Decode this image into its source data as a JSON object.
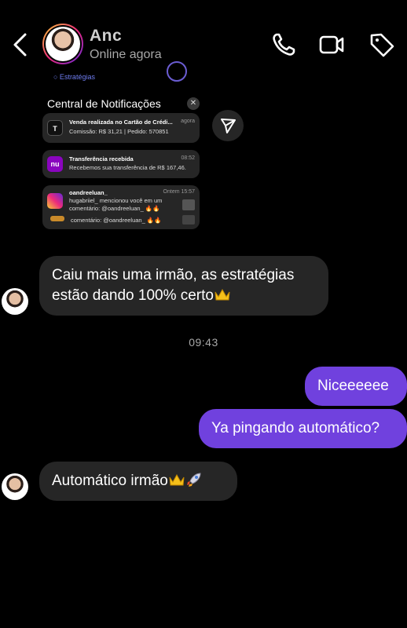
{
  "header": {
    "contact_name": "Anc",
    "status": "Online agora"
  },
  "screenshot": {
    "top_label": "○ Estratégias",
    "panel_title": "Central de Notificações",
    "close": "✕",
    "notifications": [
      {
        "icon_text": "T",
        "title": "Venda realizada no Cartão de Crédi...",
        "body": "Comissão: R$ 31,21 | Pedido: 570851",
        "time": "agora"
      },
      {
        "icon_text": "nu",
        "title": "Transferência recebida",
        "body": "Recebemos sua transferência de R$ 167,46.",
        "time": "08:52"
      },
      {
        "icon_text": "",
        "title": "oandreeluan_",
        "body": "hugabriiel_ mencionou você em um",
        "body2": "comentário: @oandreeluan_ 🔥🔥",
        "body3": "comentário: @oandreeluan_ 🔥🔥",
        "time": "Ontem 15:57"
      }
    ]
  },
  "messages": {
    "m1": "Caiu mais uma irmão, as estratégias",
    "m1_line2": "estão dando 100% certo",
    "timestamp": "09:43",
    "m2": "Niceeeeee",
    "m3": "Ya pingando automático?",
    "m4": "Automático irmão"
  },
  "colors": {
    "outgoing_bubble": "#7041de",
    "incoming_bubble": "#262626",
    "background": "#000000"
  },
  "icons": [
    "back-arrow-icon",
    "phone-icon",
    "video-camera-icon",
    "tag-icon",
    "send-icon",
    "crown-icon",
    "rocket-icon"
  ]
}
